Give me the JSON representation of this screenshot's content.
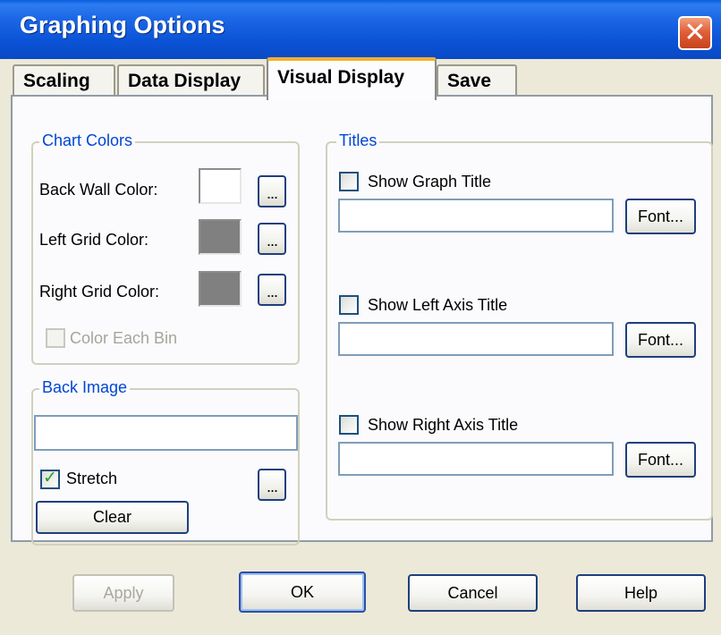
{
  "window": {
    "title": "Graphing Options",
    "close_glyph": "✕"
  },
  "tabs": [
    {
      "label": "Scaling",
      "active": false
    },
    {
      "label": "Data Display",
      "active": false
    },
    {
      "label": "Visual Display",
      "active": true
    },
    {
      "label": "Save",
      "active": false
    }
  ],
  "chart_colors": {
    "legend": "Chart Colors",
    "back_wall": {
      "label": "Back Wall Color:",
      "color": "#ffffff"
    },
    "left_grid": {
      "label": "Left Grid Color:",
      "color": "#808080"
    },
    "right_grid": {
      "label": "Right Grid Color:",
      "color": "#808080"
    },
    "color_each_bin": {
      "label": "Color Each Bin",
      "checked": false,
      "enabled": false
    },
    "browse_label": "..."
  },
  "back_image": {
    "legend": "Back Image",
    "path_value": "",
    "stretch": {
      "label": "Stretch",
      "checked": true
    },
    "browse_label": "...",
    "clear_label": "Clear"
  },
  "titles": {
    "legend": "Titles",
    "graph_title": {
      "label": "Show Graph Title",
      "checked": false,
      "value": "",
      "font_label": "Font..."
    },
    "left_axis_title": {
      "label": "Show Left Axis Title",
      "checked": false,
      "value": "",
      "font_label": "Font..."
    },
    "right_axis_title": {
      "label": "Show Right Axis Title",
      "checked": false,
      "value": "",
      "font_label": "Font..."
    }
  },
  "footer": {
    "apply": "Apply",
    "ok": "OK",
    "cancel": "Cancel",
    "help": "Help"
  }
}
